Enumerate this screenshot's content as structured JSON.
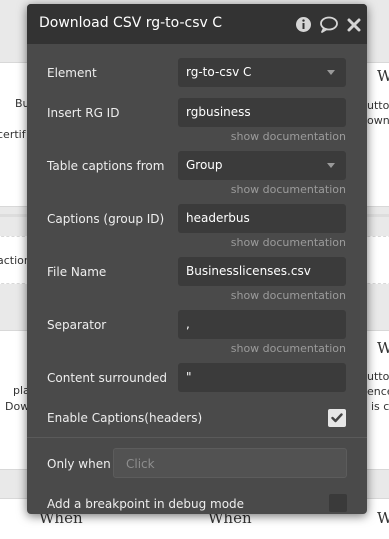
{
  "background": {
    "fragments": {
      "left_bu": "Bu",
      "left_certif": "certif",
      "left_action": "action.",
      "left_pla": "pla",
      "left_dow": "Dow",
      "right_w_top": "W",
      "right_utton": "utton",
      "right_ownlo": "ownlo",
      "right_w_mid": "W",
      "right_utto": "utto",
      "right_ence": "ence",
      "right_is_c": "is c",
      "when_1": "When",
      "when_2": "When",
      "right_w_bottom": "W"
    }
  },
  "panel": {
    "title": "Download CSV rg-to-csv C",
    "icons": {
      "info": "info-icon",
      "comment": "comment-icon",
      "close": "close-icon"
    },
    "rows": {
      "element": {
        "label": "Element",
        "value": "rg-to-csv C"
      },
      "insert_rg_id": {
        "label": "Insert RG ID",
        "value": "rgbusiness",
        "doc": "show documentation"
      },
      "table_captions_from": {
        "label": "Table captions from",
        "value": "Group",
        "doc": "show documentation"
      },
      "captions_group_id": {
        "label": "Captions (group ID)",
        "value": "headerbus",
        "doc": "show documentation"
      },
      "file_name": {
        "label": "File Name",
        "value": "Businesslicenses.csv",
        "doc": "show documentation"
      },
      "separator": {
        "label": "Separator",
        "value": ",",
        "doc": "show documentation"
      },
      "content_surrounded": {
        "label": "Content surrounded",
        "value": "\""
      },
      "enable_captions": {
        "label": "Enable Captions(headers)",
        "checked": true
      }
    },
    "only_when": {
      "label": "Only when",
      "placeholder": "Click"
    },
    "breakpoint": {
      "label": "Add a breakpoint in debug mode",
      "checked": false
    }
  }
}
